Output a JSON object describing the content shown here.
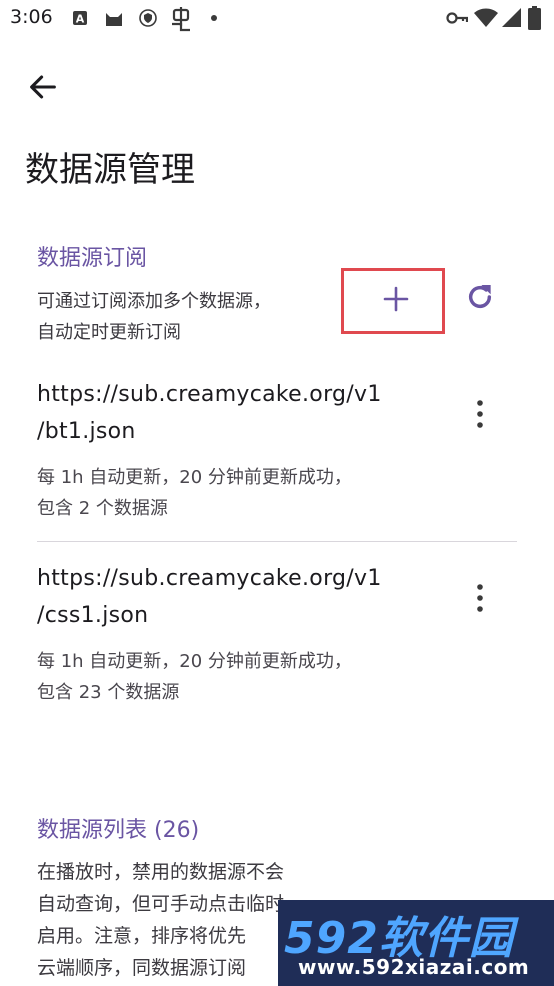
{
  "status_bar": {
    "time": "3:06",
    "left_icons": [
      "a-box-icon",
      "cat-icon",
      "shield-icon",
      "bug-icon",
      "dot-icon"
    ],
    "right_icons": [
      "key-icon",
      "wifi-icon",
      "signal-icon",
      "battery-icon"
    ]
  },
  "header": {
    "back_icon": "arrow-left-icon",
    "title": "数据源管理"
  },
  "subscriptions": {
    "section_title": "数据源订阅",
    "hint_line1": "可通过订阅添加多个数据源，",
    "hint_line2": "自动定时更新订阅",
    "add_icon": "plus-icon",
    "refresh_icon": "refresh-icon",
    "items": [
      {
        "url_line1": "https://sub.creamycake.org/v1",
        "url_line2": "/bt1.json",
        "meta_line1": "每 1h 自动更新，20 分钟前更新成功，",
        "meta_line2": "包含 2 个数据源"
      },
      {
        "url_line1": "https://sub.creamycake.org/v1",
        "url_line2": "/css1.json",
        "meta_line1": "每 1h 自动更新，20 分钟前更新成功，",
        "meta_line2": "包含 23 个数据源"
      }
    ]
  },
  "sources_list": {
    "section_title": "数据源列表 (26)",
    "desc_line1": "在播放时，禁用的数据源不会",
    "desc_line2": "自动查询，但可手动点击临时",
    "desc_line3": "启用。注意，排序将优先",
    "desc_line4": "云端顺序，同数据源订阅"
  },
  "watermark": {
    "brand": "592软件园",
    "url": "www.592xiazai.com"
  },
  "colors": {
    "accent": "#6a55a3",
    "highlight": "#e0494f"
  }
}
